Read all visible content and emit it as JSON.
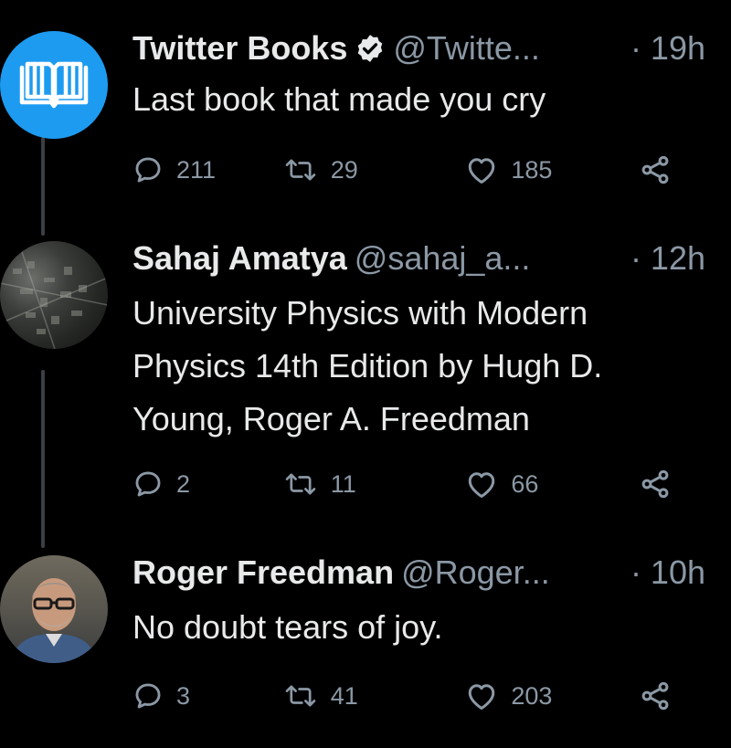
{
  "tweets": [
    {
      "name": "Twitter Books",
      "verified": true,
      "handle": "@Twitte...",
      "time": "· 19h",
      "text": "Last book that made you cry",
      "replies": "211",
      "retweets": "29",
      "likes": "185",
      "avatar_icon": "open-book-icon",
      "avatar_color": "#1d9bf0"
    },
    {
      "name": "Sahaj Amatya",
      "verified": false,
      "handle": "@sahaj_a...",
      "time": "· 12h",
      "text": "University Physics with Modern Physics 14th Edition by Hugh D. Young, Roger A. Freedman",
      "replies": "2",
      "retweets": "11",
      "likes": "66"
    },
    {
      "name": "Roger Freedman",
      "verified": false,
      "handle": "@Roger...",
      "time": "· 10h",
      "text": "No doubt tears of joy.",
      "replies": "3",
      "retweets": "41",
      "likes": "203"
    }
  ],
  "colors": {
    "background": "#000000",
    "text": "#e7e9ea",
    "muted": "#8b98a5",
    "accent": "#1d9bf0"
  }
}
